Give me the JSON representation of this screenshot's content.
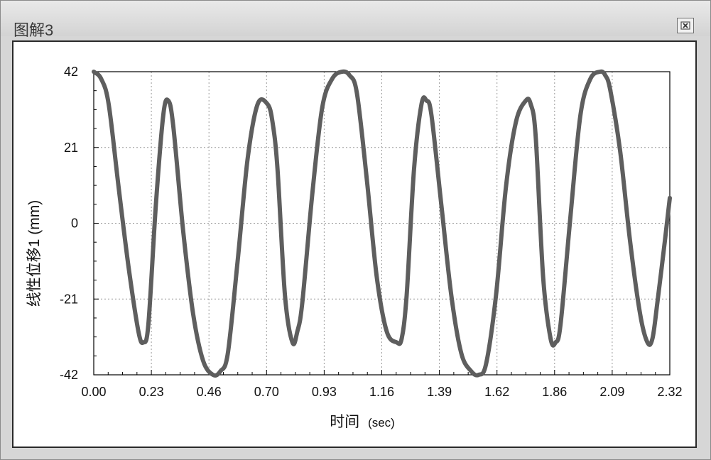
{
  "window": {
    "title": "图解3",
    "close_icon": "close-icon"
  },
  "chart_data": {
    "type": "line",
    "title": "",
    "xlabel": "时间",
    "xlabel_unit": "(sec)",
    "ylabel": "线性位移1 (mm)",
    "xlim": [
      0.0,
      2.32
    ],
    "ylim": [
      -42,
      42
    ],
    "x_ticks": [
      "0.00",
      "0.23",
      "0.46",
      "0.70",
      "0.93",
      "1.16",
      "1.39",
      "1.62",
      "1.86",
      "2.09",
      "2.32"
    ],
    "y_ticks": [
      "42",
      "21",
      "0",
      "-21",
      "-42"
    ],
    "grid": true,
    "line_color": "#5e5e5e",
    "series": [
      {
        "x": [
          0.0,
          0.03,
          0.06,
          0.1,
          0.14,
          0.18,
          0.2,
          0.22,
          0.25,
          0.28,
          0.3,
          0.32,
          0.36,
          0.4,
          0.44,
          0.48,
          0.51,
          0.54,
          0.58,
          0.62,
          0.66,
          0.7,
          0.72,
          0.74,
          0.77,
          0.8,
          0.82,
          0.84,
          0.88,
          0.92,
          0.96,
          1.0,
          1.03,
          1.06,
          1.1,
          1.14,
          1.18,
          1.22,
          1.24,
          1.26,
          1.29,
          1.32,
          1.34,
          1.36,
          1.4,
          1.44,
          1.48,
          1.52,
          1.55,
          1.58,
          1.62,
          1.66,
          1.7,
          1.74,
          1.76,
          1.78,
          1.81,
          1.84,
          1.86,
          1.88,
          1.92,
          1.96,
          2.0,
          2.04,
          2.06,
          2.08,
          2.12,
          2.16,
          2.2,
          2.23,
          2.25,
          2.27,
          2.3,
          2.32
        ],
        "y": [
          42,
          40,
          33,
          10,
          -12,
          -30,
          -33,
          -28,
          5,
          30,
          34,
          27,
          -2,
          -25,
          -38,
          -42,
          -41,
          -36,
          -10,
          18,
          33,
          33,
          28,
          15,
          -20,
          -33,
          -30,
          -22,
          8,
          32,
          40,
          42,
          41,
          36,
          12,
          -15,
          -30,
          -33,
          -32,
          -20,
          15,
          33,
          34,
          30,
          5,
          -20,
          -36,
          -41,
          -42,
          -39,
          -20,
          10,
          28,
          34,
          33,
          24,
          -15,
          -32,
          -33,
          -28,
          2,
          30,
          40,
          42,
          41,
          37,
          20,
          -5,
          -25,
          -33,
          -32,
          -22,
          -5,
          7
        ]
      }
    ]
  }
}
